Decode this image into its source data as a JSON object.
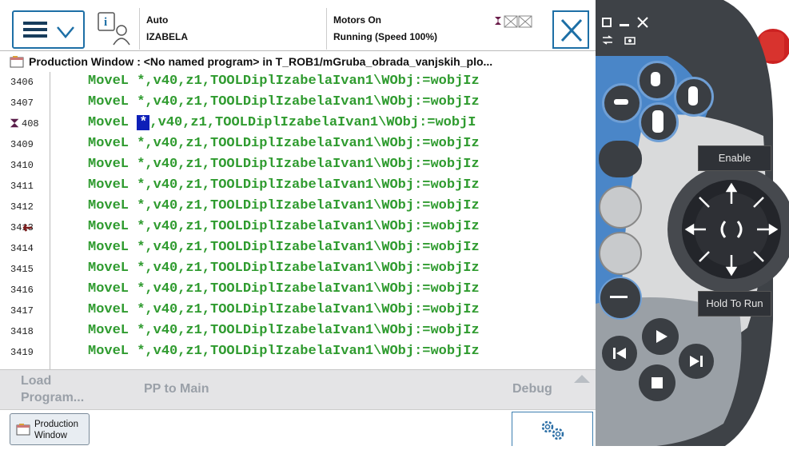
{
  "header": {
    "mode": "Auto",
    "controller": "IZABELA",
    "motors": "Motors On",
    "state": "Running (Speed 100%)",
    "menu_icon": "hamburger-chevron-icon",
    "user_icon": "info-user-icon",
    "close_icon": "close-x-icon"
  },
  "title_bar": {
    "text": "Production Window : <No named program> in T_ROB1/mGruba_obrada_vanjskih_plo..."
  },
  "code": {
    "lines": [
      {
        "num": "3406",
        "text": "MoveL *,v40,z1,TOOLDiplIzabelaIvan1\\WObj:=wobjIz"
      },
      {
        "num": "3407",
        "text": "MoveL *,v40,z1,TOOLDiplIzabelaIvan1\\WObj:=wobjIz"
      },
      {
        "num": "408",
        "pre": "MoveL ",
        "selected": "*",
        "post": ",v40,z1,TOOLDiplIzabelaIvan1\\WObj:=wobjI",
        "program_pointer": true
      },
      {
        "num": "3409",
        "text": "MoveL *,v40,z1,TOOLDiplIzabelaIvan1\\WObj:=wobjIz"
      },
      {
        "num": "3410",
        "text": "MoveL *,v40,z1,TOOLDiplIzabelaIvan1\\WObj:=wobjIz"
      },
      {
        "num": "3411",
        "text": "MoveL *,v40,z1,TOOLDiplIzabelaIvan1\\WObj:=wobjIz"
      },
      {
        "num": "3412",
        "text": "MoveL *,v40,z1,TOOLDiplIzabelaIvan1\\WObj:=wobjIz"
      },
      {
        "num": "3413",
        "text": "MoveL *,v40,z1,TOOLDiplIzabelaIvan1\\WObj:=wobjIz",
        "motion_pointer": true
      },
      {
        "num": "3414",
        "text": "MoveL *,v40,z1,TOOLDiplIzabelaIvan1\\WObj:=wobjIz"
      },
      {
        "num": "3415",
        "text": "MoveL *,v40,z1,TOOLDiplIzabelaIvan1\\WObj:=wobjIz"
      },
      {
        "num": "3416",
        "text": "MoveL *,v40,z1,TOOLDiplIzabelaIvan1\\WObj:=wobjIz"
      },
      {
        "num": "3417",
        "text": "MoveL *,v40,z1,TOOLDiplIzabelaIvan1\\WObj:=wobjIz"
      },
      {
        "num": "3418",
        "text": "MoveL *,v40,z1,TOOLDiplIzabelaIvan1\\WObj:=wobjIz"
      },
      {
        "num": "3419",
        "text": "MoveL *,v40,z1,TOOLDiplIzabelaIvan1\\WObj:=wobjIz"
      }
    ]
  },
  "command_bar": {
    "load_program_1": "Load",
    "load_program_2": "Program...",
    "pp_to_main": "PP to Main",
    "debug": "Debug"
  },
  "taskbar": {
    "production_window_1": "Production",
    "production_window_2": "Window",
    "quickset_icon": "gears-icon"
  },
  "device": {
    "enable_label": "Enable",
    "hold_to_run_label": "Hold To Run"
  },
  "colors": {
    "code_green": "#2f9b2f",
    "selection_blue": "#0d1fb8",
    "accent_blue": "#1d6fa6",
    "device_grey": "#3b3f44",
    "device_blue": "#4a86c8",
    "device_yellow": "#f2e200"
  }
}
